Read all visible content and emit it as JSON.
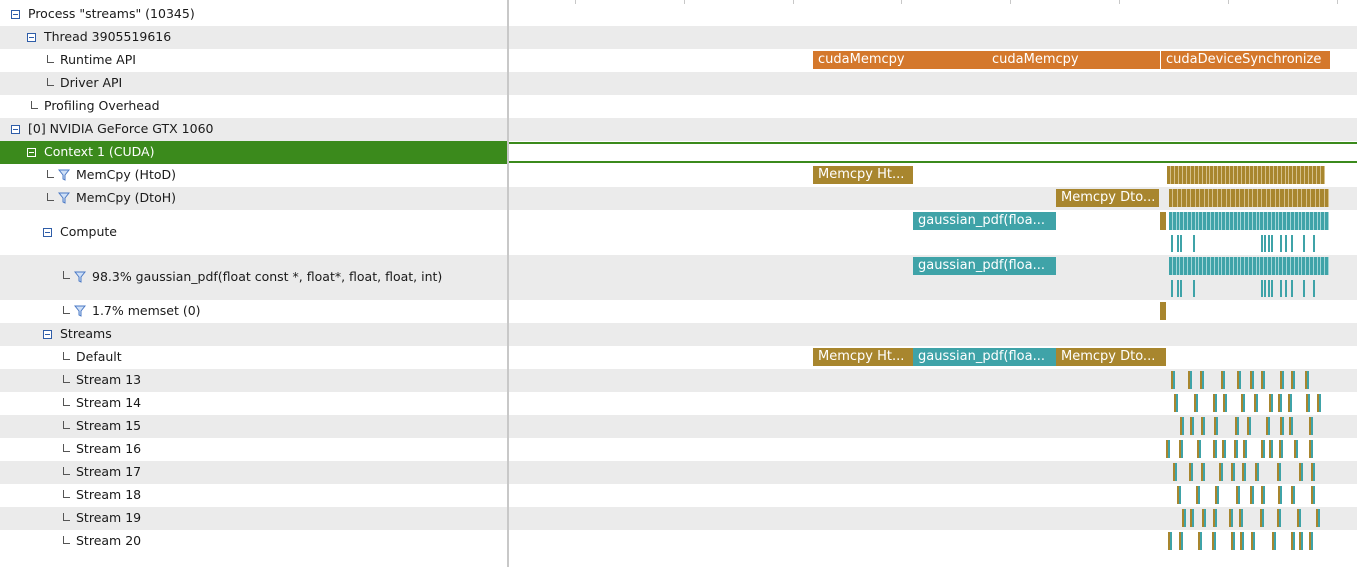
{
  "tree": {
    "process": "Process \"streams\" (10345)",
    "thread": "Thread 3905519616",
    "runtime_api": "Runtime API",
    "driver_api": "Driver API",
    "profiling_overhead": "Profiling Overhead",
    "device": "[0] NVIDIA GeForce GTX 1060",
    "context": "Context 1 (CUDA)",
    "memcpy_htod": "MemCpy (HtoD)",
    "memcpy_dtoh": "MemCpy (DtoH)",
    "compute": "Compute",
    "kernel_gaussian": "98.3% gaussian_pdf(float const *, float*, float, float, int)",
    "kernel_memset": "1.7% memset (0)",
    "streams": "Streams",
    "stream_default": "Default",
    "stream_13": "Stream 13",
    "stream_14": "Stream 14",
    "stream_15": "Stream 15",
    "stream_16": "Stream 16",
    "stream_17": "Stream 17",
    "stream_18": "Stream 18",
    "stream_19": "Stream 19",
    "stream_20": "Stream 20"
  },
  "timeline": {
    "runtime_cudaMemcpy_1": "cudaMemcpy",
    "runtime_cudaMemcpy_2": "cudaMemcpy",
    "runtime_cudaDeviceSynchronize": "cudaDeviceSynchronize",
    "htod_memcpy": "Memcpy Ht...",
    "dtoh_memcpy": "Memcpy Dto...",
    "compute_gaussian": "gaussian_pdf(floa...",
    "kernel_gaussian_bar": "gaussian_pdf(floa...",
    "default_memcpy_htod": "Memcpy Ht...",
    "default_gaussian": "gaussian_pdf(floa...",
    "default_memcpy_dtoh": "Memcpy Dto..."
  },
  "colors": {
    "selection": "#3b8a1c",
    "runtime_api": "#d4782c",
    "memcpy": "#a8862e",
    "kernel": "#3fa3a8",
    "toggle_border": "#2f5da8",
    "filter_icon": "#4a78c4"
  },
  "icons": {
    "expand_toggle": "minus-box-icon",
    "filter": "filter-funnel-icon",
    "tree_branch": "tree-elbow-icon"
  }
}
